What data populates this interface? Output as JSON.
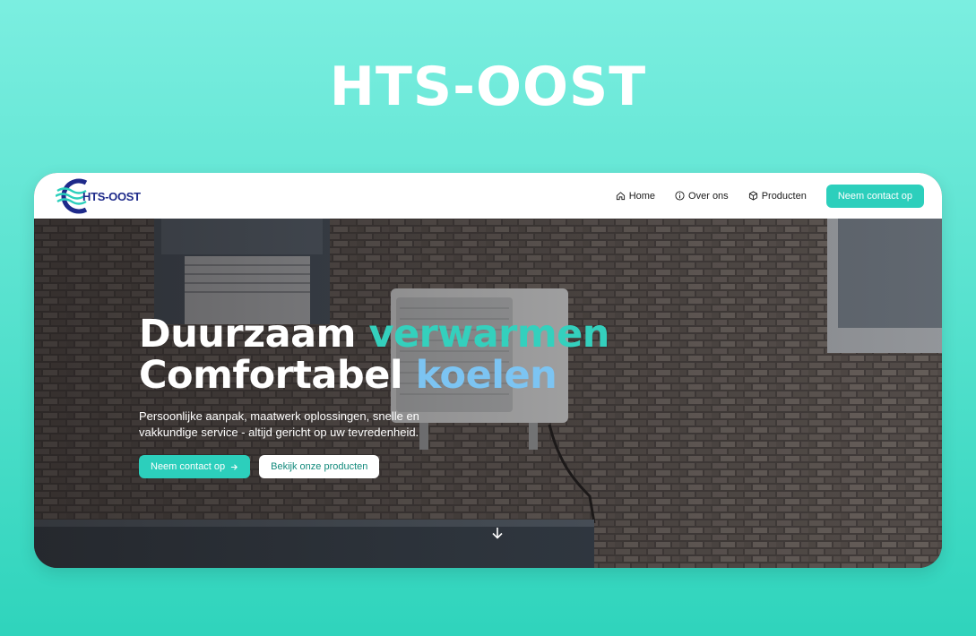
{
  "page": {
    "heading": "HTS-OOST"
  },
  "nav": {
    "logo_text": "HTS-OOST",
    "items": [
      {
        "label": "Home",
        "icon": "home-icon"
      },
      {
        "label": "Over ons",
        "icon": "info-icon"
      },
      {
        "label": "Producten",
        "icon": "box-icon"
      }
    ],
    "cta_label": "Neem contact op"
  },
  "hero": {
    "title_line1_plain": "Duurzaam ",
    "title_line1_accent": "verwarmen",
    "title_line2_plain": "Comfortabel ",
    "title_line2_accent": "koelen",
    "subtitle": "Persoonlijke aanpak, maatwerk oplossingen, snelle en vakkundige service - altijd gericht op uw tevredenheid.",
    "primary_button": "Neem contact op",
    "secondary_button": "Bekijk onze producten",
    "scroll_icon": "arrow-down-icon"
  },
  "colors": {
    "accent_teal": "#2ccfbc",
    "accent_blue": "#7cc4f2",
    "logo_navy": "#1e2a8a"
  }
}
